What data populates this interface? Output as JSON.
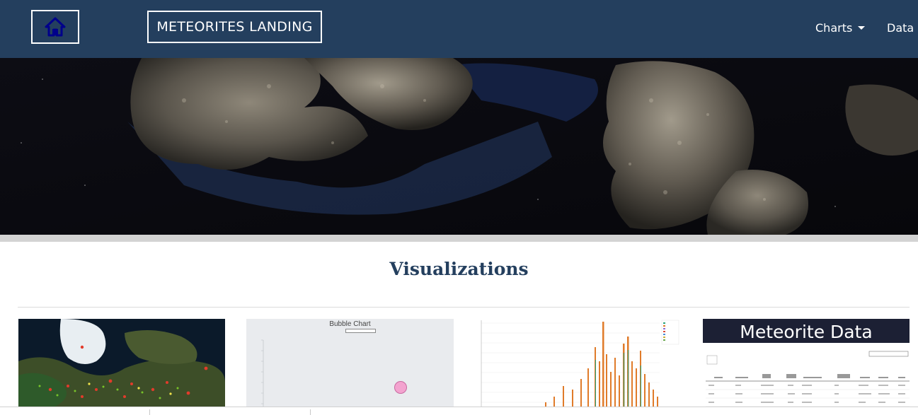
{
  "navbar": {
    "home_icon": "home-icon",
    "brand_label": "METEORITES LANDING",
    "charts_label": "Charts",
    "data_label": "Data",
    "colors": {
      "background": "#243f5e",
      "home_icon": "#00008b"
    }
  },
  "section": {
    "title": "Visualizations"
  },
  "thumbnails": {
    "bubble": {
      "title": "Bubble Chart"
    },
    "table": {
      "title": "Meteorite Data"
    }
  }
}
